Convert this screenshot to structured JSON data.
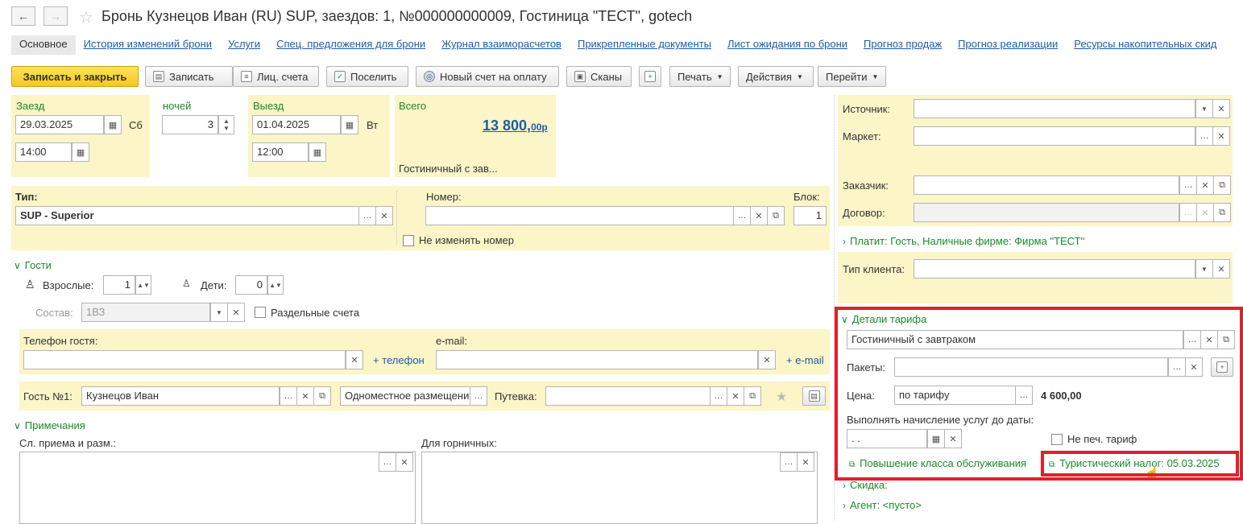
{
  "header": {
    "title": "Бронь Кузнецов Иван (RU) SUP, заездов: 1, №000000000009, Гостиница \"ТЕСТ\", gotech",
    "back": "←",
    "forward": "→"
  },
  "tabs": [
    "Основное",
    "История изменений брони",
    "Услуги",
    "Спец. предложения для брони",
    "Журнал взаиморасчетов",
    "Прикрепленные документы",
    "Лист ожидания по брони",
    "Прогноз продаж",
    "Прогноз реализации",
    "Ресурсы накопительных скид"
  ],
  "toolbar": {
    "save_close": "Записать и закрыть",
    "save": "Записать",
    "accounts": "Лиц. счета",
    "checkin": "Поселить",
    "new_invoice": "Новый счет на оплату",
    "scans": "Сканы",
    "print": "Печать",
    "actions": "Действия",
    "goto": "Перейти"
  },
  "arrival": {
    "label": "Заезд",
    "date": "29.03.2025",
    "weekday": "Сб",
    "time": "14:00"
  },
  "nights": {
    "label": "ночей",
    "value": "3"
  },
  "departure": {
    "label": "Выезд",
    "date": "01.04.2025",
    "weekday": "Вт",
    "time": "12:00"
  },
  "total": {
    "label": "Всего",
    "amount": "13 800,",
    "kop": "00",
    "cur": "р",
    "tariff": "Гостиничный с зав..."
  },
  "room": {
    "type_label": "Тип:",
    "type_value": "SUP - Superior",
    "number_label": "Номер:",
    "block_label": "Блок:",
    "block_value": "1",
    "keep_number": "Не изменять номер"
  },
  "guests": {
    "section": "Гости",
    "adults_label": "Взрослые:",
    "adults": "1",
    "children_label": "Дети:",
    "children": "0",
    "composition_label": "Состав:",
    "composition": "1ВЗ",
    "separate_accounts": "Раздельные счета",
    "phone_label": "Телефон гостя:",
    "add_phone": "+ телефон",
    "email_label": "e-mail:",
    "add_email": "+ e-mail",
    "guest1_label": "Гость №1:",
    "guest1": "Кузнецов Иван",
    "accommodation": "Одноместное размещени",
    "voucher_label": "Путевка:"
  },
  "notes": {
    "section": "Примечания",
    "reception_label": "Сл. приема и разм.:",
    "housekeeping_label": "Для горничных:"
  },
  "right": {
    "source_label": "Источник:",
    "market_label": "Маркет:",
    "customer_label": "Заказчик:",
    "contract_label": "Договор:",
    "payer": "Платит: Гость, Наличные фирме: Фирма \"ТЕСТ\"",
    "client_type_label": "Тип клиента:"
  },
  "rate": {
    "section": "Детали тарифа",
    "tariff": "Гостиничный с завтраком",
    "packages_label": "Пакеты:",
    "price_label": "Цена:",
    "price_mode": "по тарифу",
    "price": "4 600,00",
    "accrue_label": "Выполнять начисление услуг до даты:",
    "accrue_date": "  .  .",
    "no_print": "Не печ. тариф",
    "upgrade": "Повышение класса обслуживания",
    "tourist_tax": "Туристический налог: 05.03.2025"
  },
  "discount": "Скидка:",
  "agent": "Агент: <пусто>"
}
